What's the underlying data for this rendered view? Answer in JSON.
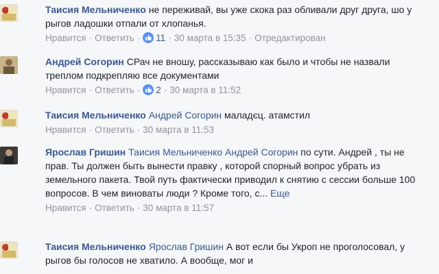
{
  "comments": [
    {
      "author": "Таисия Мельниченко",
      "text": "не переживай, вы уже скока раз обливали друг друга, шо у рыгов ладошки отпали от хлопанья.",
      "like_label": "Нравится",
      "reply_label": "Ответить",
      "likes": "11",
      "time": "30 марта в 15:35",
      "edited": "Отредактирован"
    },
    {
      "author": "Андрей Согорин",
      "text": "СРач не вношу, рассказываю как было и чтобы не назвали треплом подкрепляю все документами",
      "like_label": "Нравится",
      "reply_label": "Ответить",
      "likes": "2",
      "time": "30 марта в 11:52"
    },
    {
      "author": "Таисия Мельниченко",
      "mention": "Андрей Согорин",
      "text": "маладєц. атамстил",
      "like_label": "Нравится",
      "reply_label": "Ответить",
      "time": "30 марта в 11:53"
    },
    {
      "author": "Ярослав Гришин",
      "mention1": "Таисия Мельниченко",
      "mention2": "Андрей Согорин",
      "text": "по сути. Андрей , ты не прав. Ты должен быть вынести правку , которой спорный вопрос убрать из земельного пакета. Твой путь фактически приводил к снятию с сессии больше 100 вопросов. В чем виноваты люди ? Кроме того, с...",
      "more_label": "Еще",
      "like_label": "Нравится",
      "reply_label": "Ответить",
      "time": "30 марта в 11:57"
    },
    {
      "author": "Таисия Мельниченко",
      "mention": "Ярослав Гришин",
      "text": "А вот если бы Укроп не проголосовал, у рыгов бы голосов не хватило. А вообще, мог и"
    }
  ],
  "colors": {
    "link": "#365899",
    "meta": "#90949c",
    "text": "#1d2129",
    "like_blue": "#5890ff"
  },
  "icons": {
    "like": "thumbs-up-icon"
  }
}
